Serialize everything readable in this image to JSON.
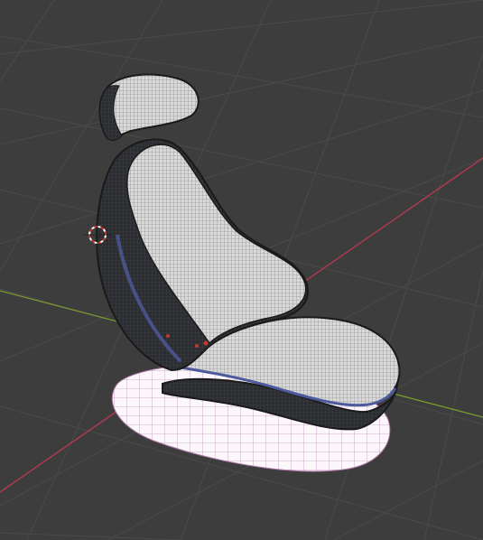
{
  "viewport": {
    "background_color": "#3d3d3d",
    "grid_color": "#4a4a4a",
    "x_axis_color": "#b03a4e",
    "y_axis_color": "#7a9a2e",
    "mesh_dark_color": "#2b2d31",
    "mesh_light_color": "#dcdcdc",
    "mesh_edge_color": "#5a6ab8",
    "base_fill_color": "#ffffff",
    "base_wire_color": "#c8a4c2",
    "cursor_color": "#c0392b"
  },
  "scene": {
    "objects": [
      {
        "name": "headrest",
        "icon": "headrest-mesh"
      },
      {
        "name": "backrest",
        "icon": "backrest-mesh"
      },
      {
        "name": "seat-cushion",
        "icon": "cushion-mesh"
      },
      {
        "name": "base-plate",
        "icon": "base-mesh"
      }
    ],
    "cursor_icon": "3d-cursor-icon"
  }
}
